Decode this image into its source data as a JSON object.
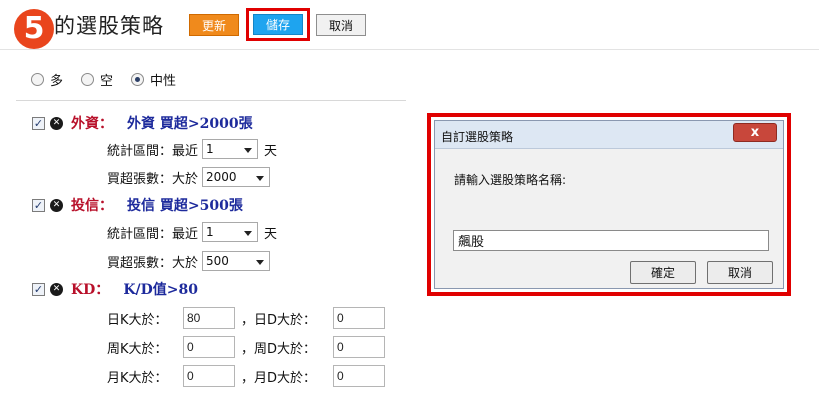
{
  "header": {
    "step_number": "5",
    "title": "的選股策略",
    "update_label": "更新",
    "save_label": "儲存",
    "cancel_label": "取消"
  },
  "direction": {
    "options": [
      "多",
      "空",
      "中性"
    ],
    "selected": "中性"
  },
  "rules": [
    {
      "name": "外資：",
      "desc": "外資 買超>2000張",
      "fields": [
        {
          "label": "統計區間：最近",
          "value": "1",
          "unit": "天"
        },
        {
          "label": "買超張數：大於",
          "value": "2000",
          "unit": ""
        }
      ]
    },
    {
      "name": "投信：",
      "desc": "投信 買超>500張",
      "fields": [
        {
          "label": "統計區間：最近",
          "value": "1",
          "unit": "天"
        },
        {
          "label": "買超張數：大於",
          "value": "500",
          "unit": ""
        }
      ]
    },
    {
      "name": "KD：",
      "desc": "K/D值>80",
      "kd_rows": [
        {
          "label1": "日K大於：",
          "value1": "80",
          "label2": "，日D大於：",
          "value2": "0"
        },
        {
          "label1": "周K大於：",
          "value1": "0",
          "label2": "，周D大於：",
          "value2": "0"
        },
        {
          "label1": "月K大於：",
          "value1": "0",
          "label2": "，月D大於：",
          "value2": "0"
        }
      ]
    }
  ],
  "dialog": {
    "title": "自訂選股策略",
    "close_label": "x",
    "prompt": "請輸入選股策略名稱:",
    "input_value": "飆股",
    "ok_label": "確定",
    "cancel_label": "取消"
  },
  "colors": {
    "badge": "#e9451d",
    "update_button": "#f08a1c",
    "save_button": "#1ea4ef",
    "highlight_border": "#e00000",
    "rule_name": "#b8102a",
    "rule_desc": "#1d2a9c"
  },
  "icons": {
    "checkbox": "checkbox-checked-icon",
    "remove": "remove-circle-icon",
    "dropdown": "chevron-down-icon"
  }
}
